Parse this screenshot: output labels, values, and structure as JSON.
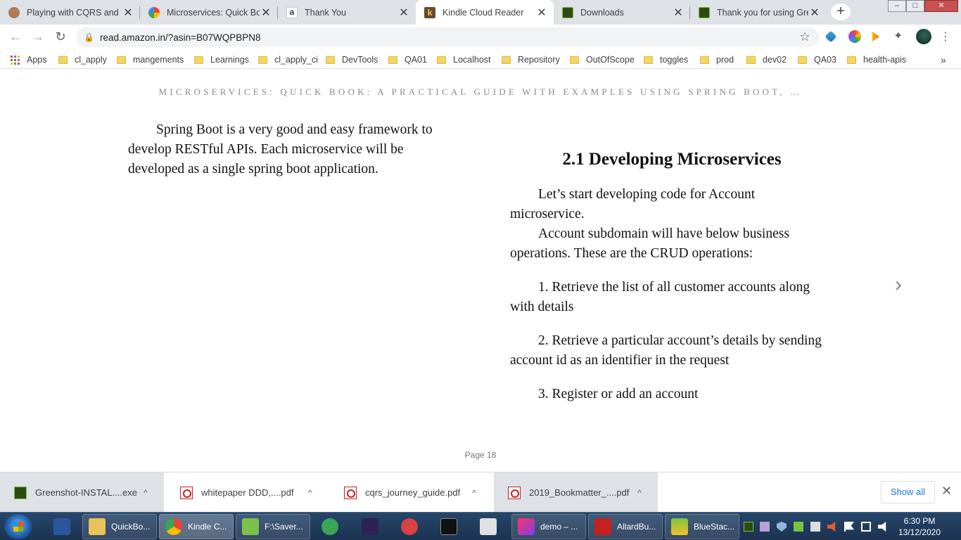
{
  "browser": {
    "tabs": [
      {
        "title": "Playing with CQRS and E",
        "favicon": "person-avatar-icon",
        "close": "✕"
      },
      {
        "title": "Microservices: Quick Boo",
        "favicon": "google-icon",
        "close": "✕"
      },
      {
        "title": "Thank You",
        "favicon": "amazon-icon",
        "close": "✕"
      },
      {
        "title": "Kindle Cloud Reader",
        "favicon": "kindle-icon",
        "close": "✕",
        "active": true
      },
      {
        "title": "Downloads",
        "favicon": "greenshot-icon",
        "close": "✕"
      },
      {
        "title": "Thank you for using Gree",
        "favicon": "greenshot-icon",
        "close": "✕"
      }
    ],
    "new_tab": "+",
    "window_controls": {
      "minimize": "–",
      "maximize": "□",
      "close": "✕"
    },
    "url": "read.amazon.in/?asin=B07WQPBPN8",
    "bookmarks": [
      "Apps",
      "cl_apply",
      "mangements",
      "Learnings",
      "cl_apply_ci",
      "DevTools",
      "QA01",
      "Localhost",
      "Repository",
      "OutOfScope",
      "toggles",
      "prod",
      "dev02",
      "QA03",
      "health-apis"
    ],
    "bookmarks_overflow": "»"
  },
  "reader": {
    "book_title": "MICROSERVICES: QUICK BOOK: A PRACTICAL GUIDE WITH EXAMPLES USING SPRING BOOT, …",
    "left_paragraph": "Spring Boot is a very good and easy framework to develop RESTful APIs. Each microservice will be developed as a single spring boot application.",
    "heading": "2.1 Developing Microservices",
    "paragraphs": [
      "Let’s start developing code for Account microservice.",
      "Account subdomain will have below business operations. These are the CRUD operations:"
    ],
    "list": [
      "1. Retrieve the list of all customer accounts along with details",
      "2. Retrieve a particular account’s details by sending account id as an identifier in the request",
      "3. Register or add an account"
    ],
    "page_label": "Page 18",
    "next_page_icon": "chevron-right-icon"
  },
  "downloads": {
    "items": [
      {
        "name": "Greenshot-INSTAL....exe",
        "icon": "greenshot-icon"
      },
      {
        "name": "whitepaper DDD,....pdf",
        "icon": "pdf-icon"
      },
      {
        "name": "cqrs_journey_guide.pdf",
        "icon": "pdf-icon"
      },
      {
        "name": "2019_Bookmatter_....pdf",
        "icon": "pdf-icon"
      }
    ],
    "caret": "^",
    "show_all": "Show all",
    "close": "✕"
  },
  "taskbar": {
    "items": [
      {
        "label": "",
        "icon": "word-icon",
        "color": "#2b579a"
      },
      {
        "label": "QuickBo...",
        "icon": "folder-icon",
        "color": "#e8c25a"
      },
      {
        "label": "Kindle C...",
        "icon": "chrome-icon",
        "color": "#4285f4"
      },
      {
        "label": "F:\\Saver...",
        "icon": "notepadpp-icon",
        "color": "#7cc04a"
      },
      {
        "label": "",
        "icon": "clock-app-icon",
        "color": "#3aa655"
      },
      {
        "label": "",
        "icon": "eclipse-icon",
        "color": "#2c2255"
      },
      {
        "label": "",
        "icon": "snipping-tool-icon",
        "color": "#d84343"
      },
      {
        "label": "",
        "icon": "cmd-icon",
        "color": "#111111"
      },
      {
        "label": "",
        "icon": "java-icon",
        "color": "#e0e0e0"
      },
      {
        "label": "demo – ...",
        "icon": "intellij-icon",
        "color": "#fe315d"
      },
      {
        "label": "AllardBu...",
        "icon": "pdf-reader-icon",
        "color": "#c5221f"
      },
      {
        "label": "BlueStac...",
        "icon": "bluestacks-icon",
        "color": "#7ac142"
      }
    ],
    "time": "6:30 PM",
    "date": "13/12/2020"
  }
}
